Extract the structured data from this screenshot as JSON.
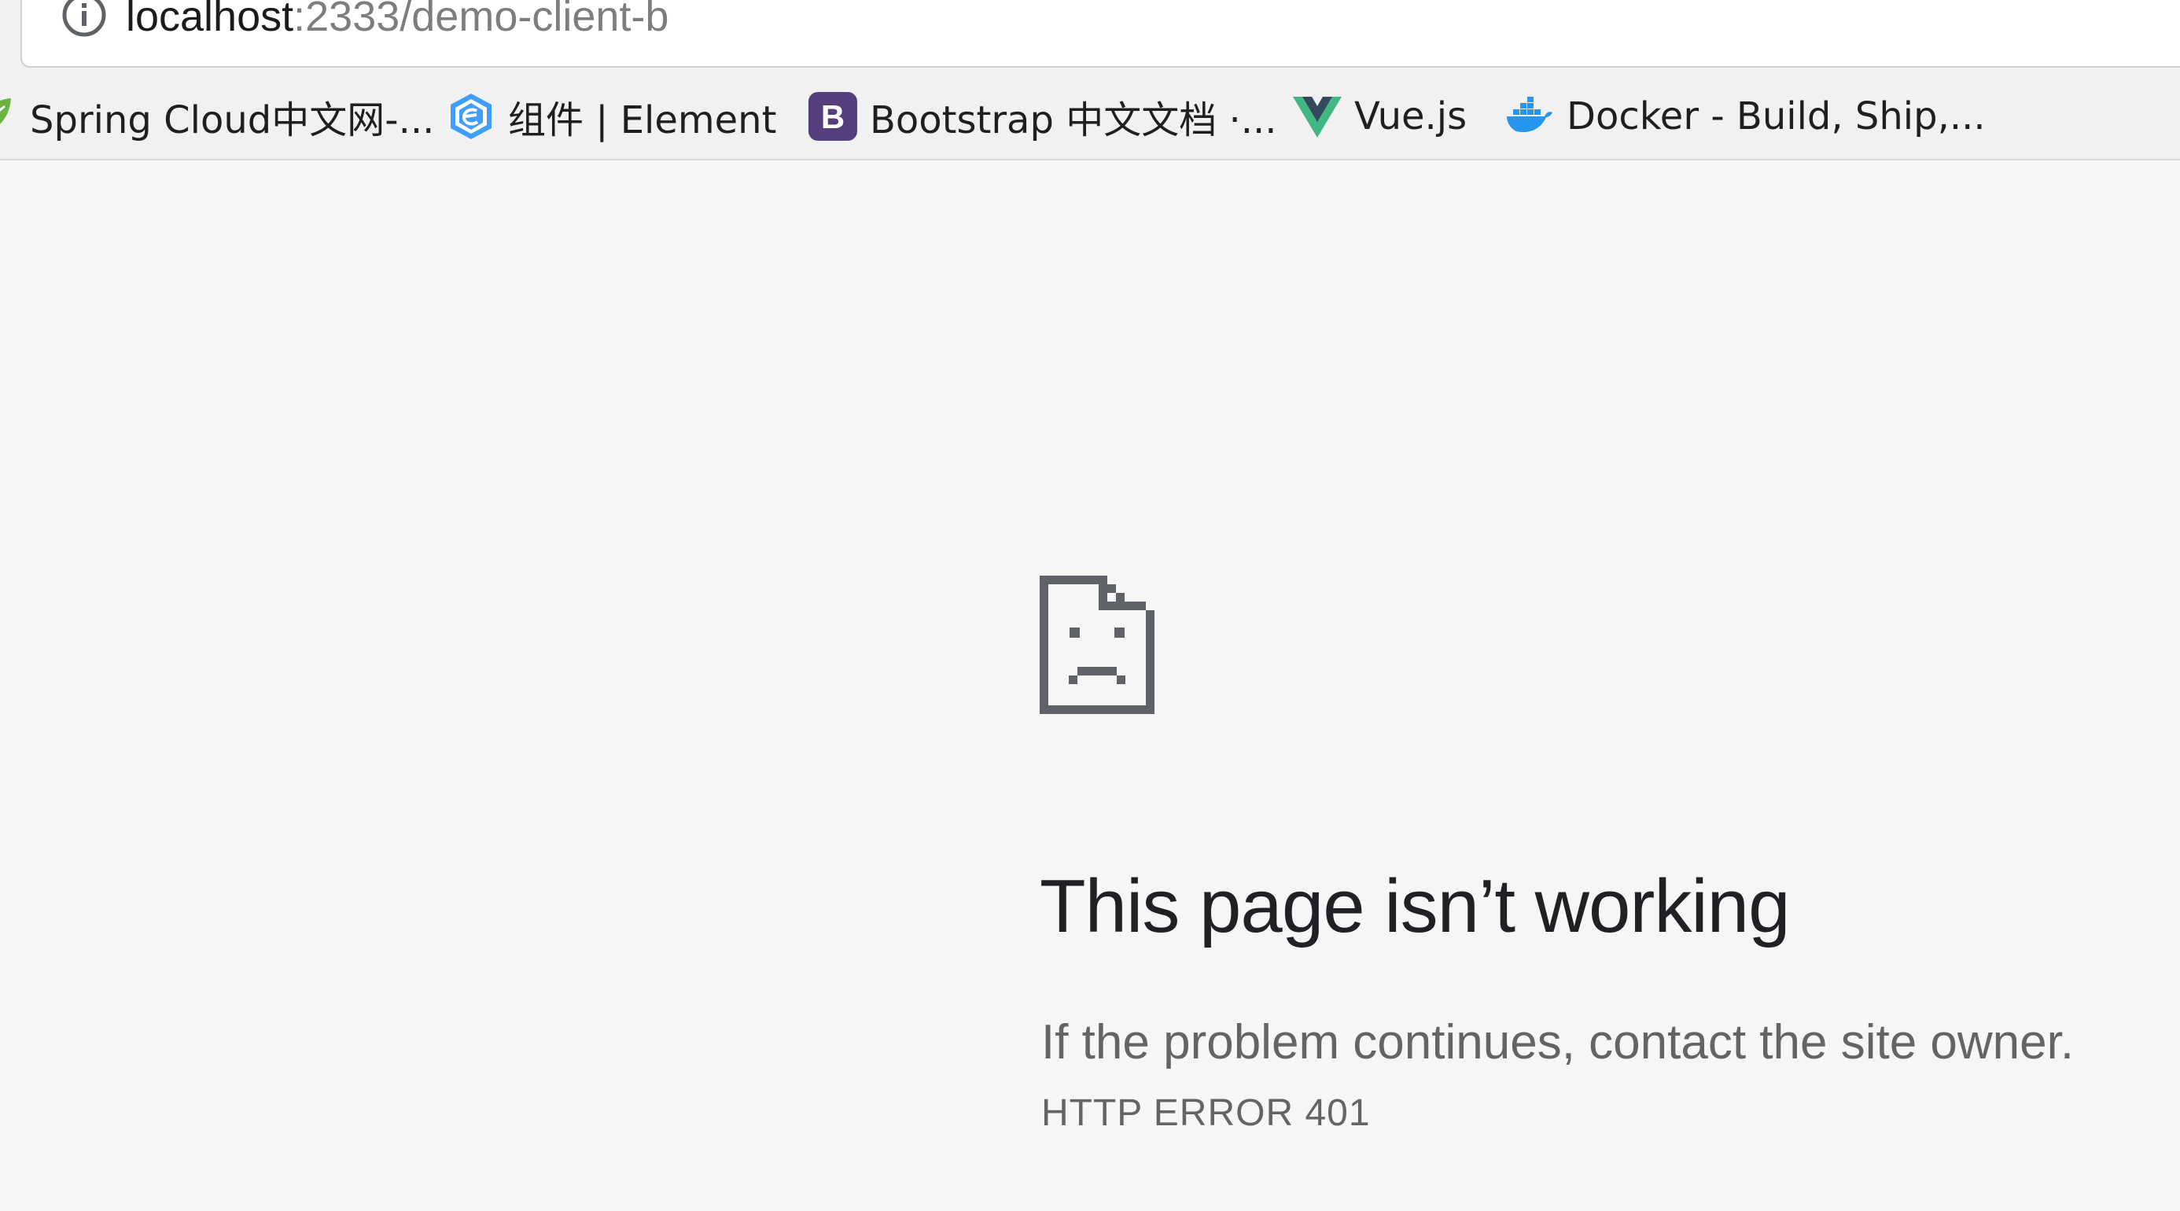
{
  "address_bar": {
    "host": "localhost",
    "path": ":2333/demo-client-b",
    "info_icon": "info-circle-icon"
  },
  "bookmarks": [
    {
      "label": "Spring Cloud中文网-...",
      "icon": "spring-leaf-icon",
      "color": "#6db33f"
    },
    {
      "label": "组件 | Element",
      "icon": "element-hexagon-icon",
      "color": "#409eff"
    },
    {
      "label": "Bootstrap 中文文档 ·...",
      "icon": "bootstrap-b-icon",
      "color": "#563d7c"
    },
    {
      "label": "Vue.js",
      "icon": "vue-v-icon",
      "color": "#41b883"
    },
    {
      "label": "Docker - Build, Ship,...",
      "icon": "docker-whale-icon",
      "color": "#2496ed"
    }
  ],
  "error": {
    "icon": "sad-document-icon",
    "title": "This page isn’t working",
    "detail": "If the problem continues, contact the site owner.",
    "code": "HTTP ERROR 401"
  },
  "colors": {
    "page_background": "#f6f6f6",
    "title_text": "#202124",
    "secondary_text": "#646464"
  }
}
